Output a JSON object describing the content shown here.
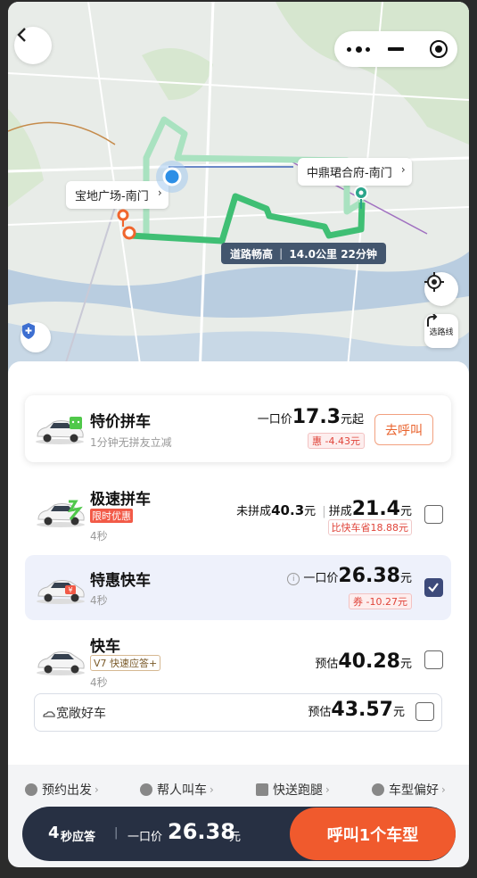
{
  "map": {
    "origin_label": "宝地广场-南门",
    "dest_label": "中鼎珺合府-南门",
    "route_status": "道路畅高",
    "route_distance": "14.0公里 22分钟",
    "route_switch_label": "选路线"
  },
  "cards": {
    "pool_special": {
      "name": "特价拼车",
      "sub": "1分钟无拼友立减",
      "price_prefix": "一口价",
      "price": "17.3",
      "price_suffix": "元起",
      "discount": "惠 -4.43元",
      "action": "去呼叫"
    },
    "pool_fast": {
      "name": "极速拼车",
      "promo": "限时优惠",
      "eta": "4秒",
      "fail_label": "未拼成",
      "fail_price": "40.3",
      "fail_unit": "元",
      "sep": "|",
      "ok_label": "拼成",
      "ok_price": "21.4",
      "ok_unit": "元",
      "saving": "比快车省18.88元",
      "checked": false
    },
    "express_discount": {
      "name": "特惠快车",
      "eta": "4秒",
      "price_prefix": "一口价",
      "price": "26.38",
      "price_unit": "元",
      "coupon": "券 -10.27元",
      "checked": true
    },
    "express": {
      "name": "快车",
      "tag": "V7 快速应答+",
      "eta": "4秒",
      "price_prefix": "预估",
      "price": "40.28",
      "price_unit": "元",
      "checked": false
    },
    "comfort": {
      "name": "宽敞好车",
      "price_prefix": "预估",
      "price": "43.57",
      "price_unit": "元",
      "checked": false
    }
  },
  "options": [
    {
      "label": "预约出发",
      "icon": "clock-icon"
    },
    {
      "label": "帮人叫车",
      "icon": "person-icon"
    },
    {
      "label": "快送跑腿",
      "icon": "box-icon"
    },
    {
      "label": "车型偏好",
      "icon": "car-pref-icon"
    }
  ],
  "bottom": {
    "eta_num": "4",
    "eta_text": "秒应答",
    "sep": "|",
    "price_prefix": "一口价",
    "price": "26.38",
    "price_unit": "元",
    "cta": "呼叫1个车型"
  },
  "colors": {
    "accent": "#f05a2d",
    "navy": "#273043",
    "route": "#3fbf74",
    "check": "#3d4a7a"
  }
}
